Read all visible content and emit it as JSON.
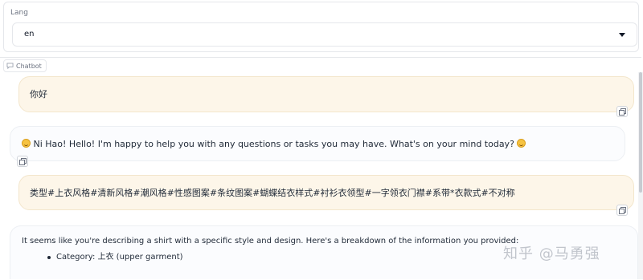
{
  "lang": {
    "label": "Lang",
    "selected": "en"
  },
  "chatbot": {
    "label": "Chatbot",
    "messages": [
      {
        "role": "user",
        "text": "你好"
      },
      {
        "role": "bot",
        "text": " Ni Hao! Hello! I'm happy to help you with any questions or tasks you may have. What's on your mind today? "
      },
      {
        "role": "user",
        "text": "类型#上衣风格#清新风格#潮风格#性感图案#条纹图案#蝴蝶结衣样式#衬衫衣领型#一字领衣门襟#系带*衣款式#不对称"
      },
      {
        "role": "bot",
        "text": "It seems like you're describing a shirt with a specific style and design. Here's a breakdown of the information you provided:",
        "bullets": [
          "Category: 上衣 (upper garment)"
        ]
      }
    ]
  },
  "watermark": "知乎 @马勇强",
  "colors": {
    "user_bubble": "#fdf6e9",
    "bot_bubble": "#fbfcfe",
    "border": "#e5e7eb"
  },
  "icons": [
    "chat-bubble-icon",
    "dropdown-caret-icon",
    "copy-icon",
    "smiley-emoji-icon"
  ]
}
